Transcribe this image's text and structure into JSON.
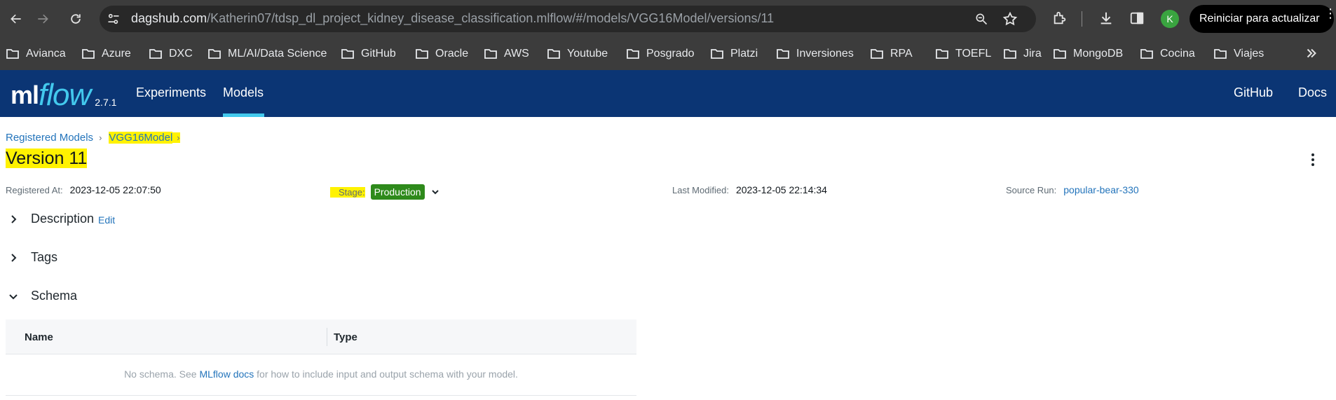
{
  "browser": {
    "url_host": "dagshub.com",
    "url_path": "/Katherin07/tdsp_dl_project_kidney_disease_classification.mlflow/#/models/VGG16Model/versions/11",
    "profile_initial": "K",
    "update_button": "Reiniciar para actualizar",
    "bookmarks": [
      "Avianca",
      "Azure",
      "DXC",
      "ML/AI/Data Science",
      "GitHub",
      "Oracle",
      "AWS",
      "Youtube",
      "Posgrado",
      "Platzi",
      "Inversiones",
      "RPA",
      "TOEFL",
      "Jira",
      "MongoDB",
      "Cocina",
      "Viajes"
    ]
  },
  "header": {
    "logo_ml": "ml",
    "logo_flow": "flow",
    "version": "2.7.1",
    "nav": [
      "Experiments",
      "Models"
    ],
    "active_nav": "Models",
    "right_links": [
      "GitHub",
      "Docs"
    ],
    "bg_color": "#0b3574",
    "accent_color": "#43c9ed"
  },
  "breadcrumb": {
    "root": "Registered Models",
    "model": "VGG16Model"
  },
  "page": {
    "title": "Version 11"
  },
  "metadata": {
    "registered_label": "Registered At:",
    "registered_value": "2023-12-05 22:07:50",
    "stage_label": "Stage:",
    "stage_value": "Production",
    "stage_color": "#2e8a1b",
    "modified_label": "Last Modified:",
    "modified_value": "2023-12-05 22:14:34",
    "source_label": "Source Run:",
    "source_value": "popular-bear-330"
  },
  "sections": {
    "description": "Description",
    "description_edit": "Edit",
    "tags": "Tags",
    "schema": "Schema"
  },
  "schema": {
    "columns": [
      "Name",
      "Type"
    ],
    "empty_prefix": "No schema. See ",
    "empty_link": "MLflow docs",
    "empty_suffix": " for how to include input and output schema with your model."
  },
  "highlight_color": "#fff200"
}
